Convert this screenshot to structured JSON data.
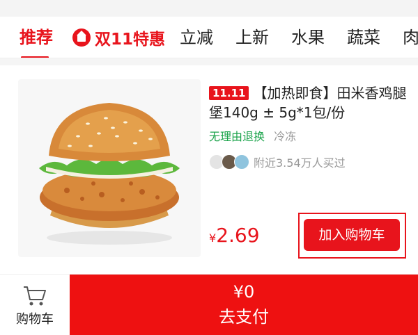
{
  "tabs": {
    "items": [
      {
        "label": "推荐",
        "active": true
      },
      {
        "label": "双11特惠",
        "icon": "shop-icon",
        "promo": true
      },
      {
        "label": "立减"
      },
      {
        "label": "上新"
      },
      {
        "label": "水果"
      },
      {
        "label": "蔬菜"
      },
      {
        "label": "肉"
      }
    ]
  },
  "product": {
    "badge": "11.11",
    "title": "【加热即食】田米香鸡腿堡140g ± 5g*1包/份",
    "tags": {
      "return": "无理由退换",
      "storage": "冷冻"
    },
    "social_proof": "附近3.54万人买过",
    "price_symbol": "¥",
    "price_value": "2.69",
    "add_to_cart": "加入购物车"
  },
  "bottom_bar": {
    "cart_label": "购物车",
    "total": "¥0",
    "pay_label": "去支付"
  },
  "colors": {
    "accent": "#e8141c",
    "green": "#1aa34a",
    "muted": "#999999"
  }
}
